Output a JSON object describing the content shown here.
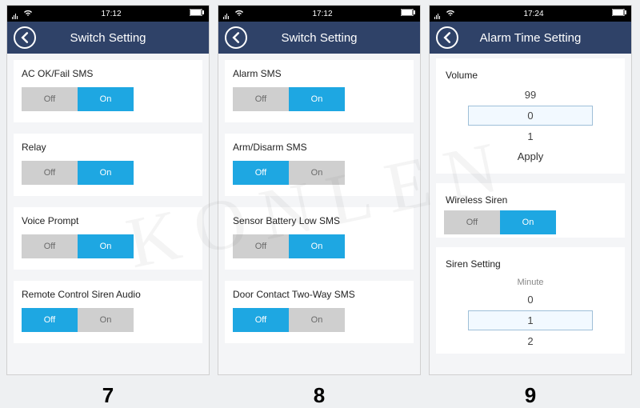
{
  "watermark": "KONLEN",
  "screens": [
    {
      "status_time": "17:12",
      "header_title": "Switch Setting",
      "page_number": "7",
      "cards": [
        {
          "title": "AC OK/Fail SMS",
          "off": "Off",
          "on": "On",
          "active": "on"
        },
        {
          "title": "Relay",
          "off": "Off",
          "on": "On",
          "active": "on"
        },
        {
          "title": "Voice Prompt",
          "off": "Off",
          "on": "On",
          "active": "on"
        },
        {
          "title": "Remote Control Siren Audio",
          "off": "Off",
          "on": "On",
          "active": "off"
        }
      ]
    },
    {
      "status_time": "17:12",
      "header_title": "Switch Setting",
      "page_number": "8",
      "cards": [
        {
          "title": "Alarm SMS",
          "off": "Off",
          "on": "On",
          "active": "on"
        },
        {
          "title": "Arm/Disarm SMS",
          "off": "Off",
          "on": "On",
          "active": "off"
        },
        {
          "title": "Sensor Battery Low SMS",
          "off": "Off",
          "on": "On",
          "active": "on"
        },
        {
          "title": "Door Contact Two-Way SMS",
          "off": "Off",
          "on": "On",
          "active": "off"
        }
      ]
    },
    {
      "status_time": "17:24",
      "header_title": "Alarm Time Setting",
      "page_number": "9",
      "volume": {
        "label": "Volume",
        "above": "99",
        "selected": "0",
        "below": "1",
        "apply": "Apply"
      },
      "wireless_siren": {
        "label": "Wireless Siren",
        "off": "Off",
        "on": "On",
        "active": "on"
      },
      "siren_setting": {
        "label": "Siren Setting",
        "unit": "Minute",
        "above": "0",
        "selected": "1",
        "below": "2"
      }
    }
  ]
}
